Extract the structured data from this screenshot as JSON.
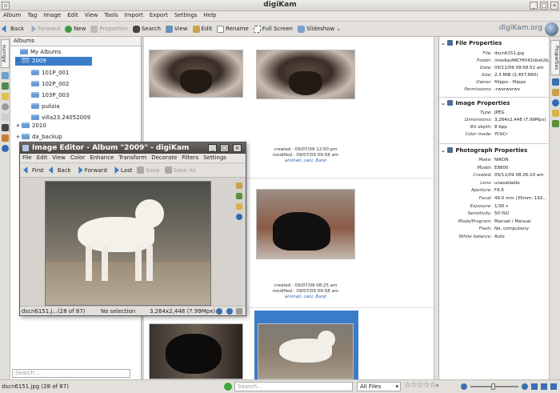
{
  "window": {
    "title": "digiKam",
    "brand": "digiKam.org"
  },
  "menu": [
    "Album",
    "Tag",
    "Image",
    "Edit",
    "View",
    "Tools",
    "Import",
    "Export",
    "Settings",
    "Help"
  ],
  "toolbar": {
    "back": "Back",
    "forward": "Forward",
    "new": "New",
    "properties": "Properties",
    "search": "Search",
    "view": "View",
    "edit": "Edit",
    "rename": "Rename",
    "fullscreen": "Full Screen",
    "slideshow": "Slideshow"
  },
  "left_tabs": {
    "albums": "Albums"
  },
  "albums": {
    "header": "Albums",
    "search_placeholder": "Search...",
    "tree": [
      {
        "label": "My Albums",
        "toggle": "",
        "selected": false
      },
      {
        "label": "2009",
        "toggle": "−",
        "selected": true
      },
      {
        "label": "101P_001",
        "toggle": "",
        "selected": false
      },
      {
        "label": "102P_002",
        "toggle": "",
        "selected": false
      },
      {
        "label": "103P_003",
        "toggle": "",
        "selected": false
      },
      {
        "label": "pulizia",
        "toggle": "",
        "selected": false
      },
      {
        "label": "villa23.24052009",
        "toggle": "",
        "selected": false
      },
      {
        "label": "2010",
        "toggle": "+",
        "selected": false
      },
      {
        "label": "da_backup",
        "toggle": "+",
        "selected": false
      }
    ]
  },
  "thumbs": [
    {
      "created": "created : 09/07/09 12:00 pm",
      "modified": "modified : 09/07/09 09:58 am",
      "tags": "animali, cani, Banji"
    },
    {
      "created": "created : 09/07/09 08:25 am",
      "modified": "modified : 09/07/09 09:58 am",
      "tags": "animali, cani, Banji"
    }
  ],
  "properties": {
    "file_title": "File Properties",
    "file": [
      {
        "k": "File:",
        "v": "dscn6151.jpg"
      },
      {
        "k": "Folder:",
        "v": "/media/ARCHIVIO/disk2b/..."
      },
      {
        "k": "Date:",
        "v": "09/11/09 09:58:52 am"
      },
      {
        "k": "Size:",
        "v": "2.3 MiB (2,457,860)"
      },
      {
        "k": "Owner:",
        "v": "filippo - filippo"
      },
      {
        "k": "Permissions:",
        "v": "-rwxrwxrwx"
      }
    ],
    "image_title": "Image Properties",
    "image": [
      {
        "k": "Type:",
        "v": "JPEG"
      },
      {
        "k": "Dimensions:",
        "v": "3,264x2,448 (7.99Mpx)"
      },
      {
        "k": "Bit depth:",
        "v": "8 bpp"
      },
      {
        "k": "Color mode:",
        "v": "YCbCr"
      }
    ],
    "photo_title": "Photograph Properties",
    "photo": [
      {
        "k": "Make:",
        "v": "NIKON"
      },
      {
        "k": "Model:",
        "v": "E8800"
      },
      {
        "k": "Created:",
        "v": "09/11/09 08:26:10 am"
      },
      {
        "k": "Lens:",
        "v": "unavailable"
      },
      {
        "k": "Aperture:",
        "v": "F4.6"
      },
      {
        "k": "Focal:",
        "v": "49.0 mm (35mm: 192..."
      },
      {
        "k": "Exposure:",
        "v": "1/30 s"
      },
      {
        "k": "Sensitivity:",
        "v": "50 ISO"
      },
      {
        "k": "Mode/Program:",
        "v": "Manual / Manual"
      },
      {
        "k": "Flash:",
        "v": "No, compulsory"
      },
      {
        "k": "White balance:",
        "v": "Auto"
      }
    ]
  },
  "right_tabs": {
    "properties": "Properties"
  },
  "statusbar": {
    "file": "dscn6151.jpg (28 of 87)",
    "search_placeholder": "Search...",
    "filter": "All Files"
  },
  "editor": {
    "title": "Image Editor - Album \"2009\" - digiKam",
    "menu": [
      "File",
      "Edit",
      "View",
      "Color",
      "Enhance",
      "Transform",
      "Decorate",
      "Filters",
      "Settings"
    ],
    "toolbar": {
      "first": "First",
      "back": "Back",
      "forward": "Forward",
      "last": "Last",
      "save": "Save",
      "save_as": "Save As"
    },
    "status": {
      "file": "dscn6151.j...(28 of 87)",
      "selection": "No selection",
      "size": "3,264x2,448 (7.99Mpx)"
    }
  },
  "colors": {
    "selection": "#3b7cc8",
    "tags": "#2d5aa8",
    "brand": "#5c6f86"
  }
}
